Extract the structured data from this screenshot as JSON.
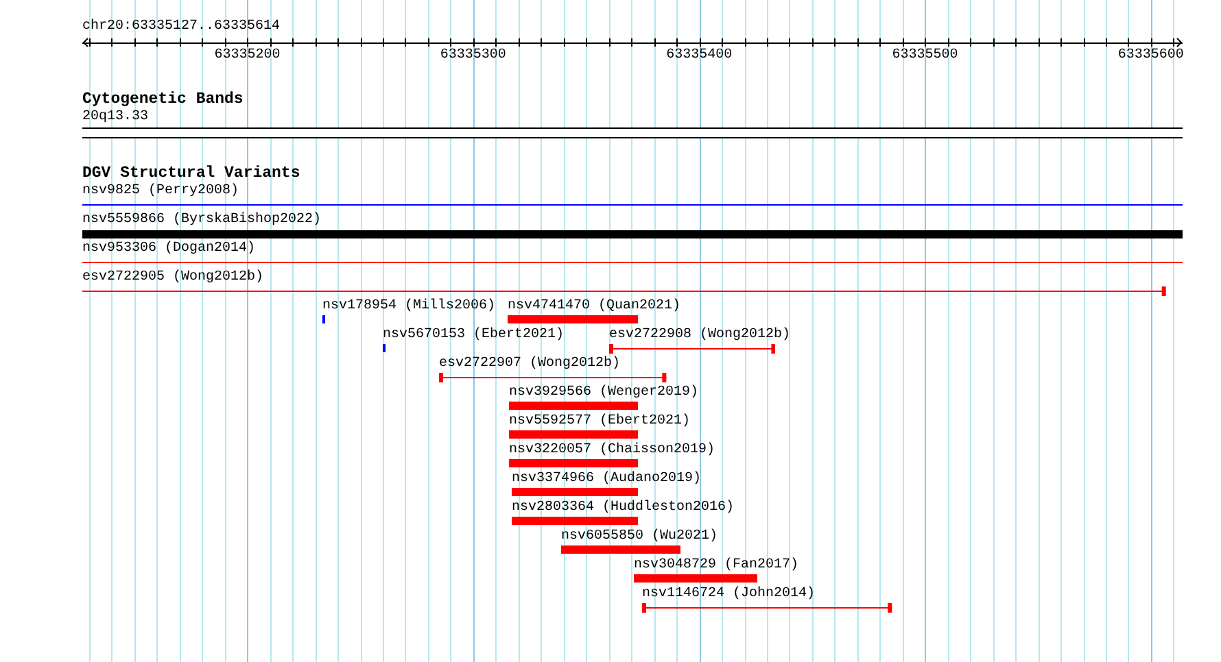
{
  "ruler": {
    "range_label": "chr20:63335127..63335614",
    "tick_labels": [
      "63335200",
      "63335300",
      "63335400",
      "63335500",
      "63335600"
    ]
  },
  "cytobands": {
    "title": "Cytogenetic Bands",
    "features": [
      {
        "label": "20q13.33"
      }
    ]
  },
  "variants": {
    "title": "DGV Structural Variants",
    "rows": [
      [
        {
          "label": "nsv9825 (Perry2008)",
          "kind": "line",
          "color": "#0000ff"
        }
      ],
      [
        {
          "label": "nsv5559866 (ByrskaBishop2022)",
          "kind": "thick",
          "color": "#000000"
        }
      ],
      [
        {
          "label": "nsv953306 (Dogan2014)",
          "kind": "line",
          "color": "#ff0000"
        }
      ],
      [
        {
          "label": "esv2722905 (Wong2012b)",
          "kind": "capped",
          "color": "#ff0000"
        }
      ],
      [
        {
          "label": "nsv178954 (Mills2006)",
          "kind": "tick",
          "color": "#0000ff"
        },
        {
          "label": "nsv4741470 (Quan2021)",
          "kind": "bar",
          "color": "#ff0000"
        }
      ],
      [
        {
          "label": "nsv5670153 (Ebert2021)",
          "kind": "tick",
          "color": "#0000ff"
        },
        {
          "label": "esv2722908 (Wong2012b)",
          "kind": "capped",
          "color": "#ff0000"
        }
      ],
      [
        {
          "label": "esv2722907 (Wong2012b)",
          "kind": "capped",
          "color": "#ff0000"
        }
      ],
      [
        {
          "label": "nsv3929566 (Wenger2019)",
          "kind": "bar",
          "color": "#ff0000"
        }
      ],
      [
        {
          "label": "nsv5592577 (Ebert2021)",
          "kind": "bar",
          "color": "#ff0000"
        }
      ],
      [
        {
          "label": "nsv3220057 (Chaisson2019)",
          "kind": "bar",
          "color": "#ff0000"
        }
      ],
      [
        {
          "label": "nsv3374966 (Audano2019)",
          "kind": "bar",
          "color": "#ff0000"
        }
      ],
      [
        {
          "label": "nsv2803364 (Huddleston2016)",
          "kind": "bar",
          "color": "#ff0000"
        }
      ],
      [
        {
          "label": "nsv6055850 (Wu2021)",
          "kind": "bar",
          "color": "#ff0000"
        }
      ],
      [
        {
          "label": "nsv3048729 (Fan2017)",
          "kind": "bar",
          "color": "#ff0000"
        }
      ],
      [
        {
          "label": "nsv1146724 (John2014)",
          "kind": "capped",
          "color": "#ff0000"
        }
      ]
    ]
  }
}
